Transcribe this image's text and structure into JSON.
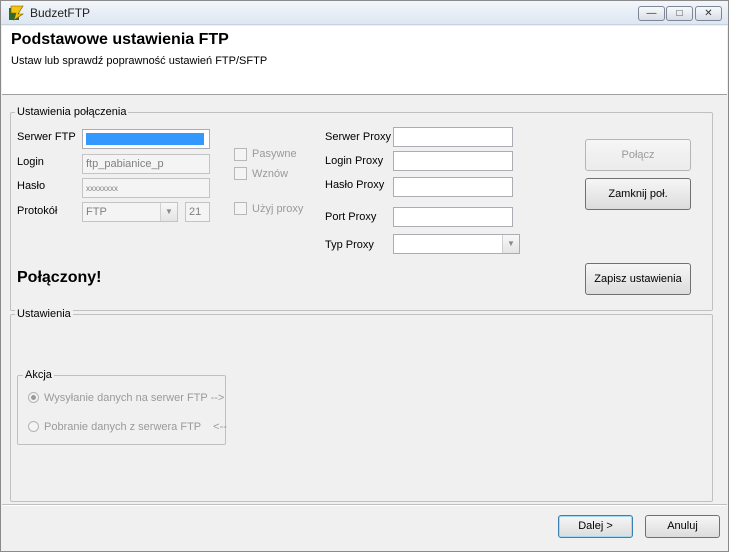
{
  "window": {
    "title": "BudzetFTP",
    "minimize_glyph": "—",
    "maximize_glyph": "□",
    "close_glyph": "✕"
  },
  "header": {
    "title": "Podstawowe ustawienia FTP",
    "subtitle": "Ustaw lub sprawdź poprawność ustawień FTP/SFTP"
  },
  "connection": {
    "group_label": "Ustawienia połączenia",
    "server_label": "Serwer FTP",
    "server_value": "",
    "login_label": "Login",
    "login_value": "ftp_pabianice_p",
    "password_label": "Hasło",
    "password_value": "xxxxxxxx",
    "protocol_label": "Protokół",
    "protocol_value": "FTP",
    "port_value": "21",
    "passive_label": "Pasywne",
    "resume_label": "Wznów",
    "use_proxy_label": "Użyj proxy"
  },
  "proxy": {
    "server_label": "Serwer Proxy",
    "server_value": "",
    "login_label": "Login Proxy",
    "login_value": "",
    "password_label": "Hasło Proxy",
    "password_value": "",
    "port_label": "Port Proxy",
    "port_value": "",
    "type_label": "Typ Proxy",
    "type_value": ""
  },
  "buttons": {
    "connect": "Połącz",
    "disconnect": "Zamknij poł.",
    "save": "Zapisz ustawienia",
    "next": "Dalej >",
    "cancel": "Anuluj"
  },
  "status_text": "Połączony!",
  "settings": {
    "group_label": "Ustawienia",
    "action_label": "Akcja",
    "send_option": "Wysyłanie danych na serwer FTP -->",
    "receive_option": "Pobranie danych z serwera FTP    <--",
    "selected_option": "send"
  },
  "colors": {
    "selection": "#3399ff",
    "disabled_text": "#9a9a9a"
  }
}
